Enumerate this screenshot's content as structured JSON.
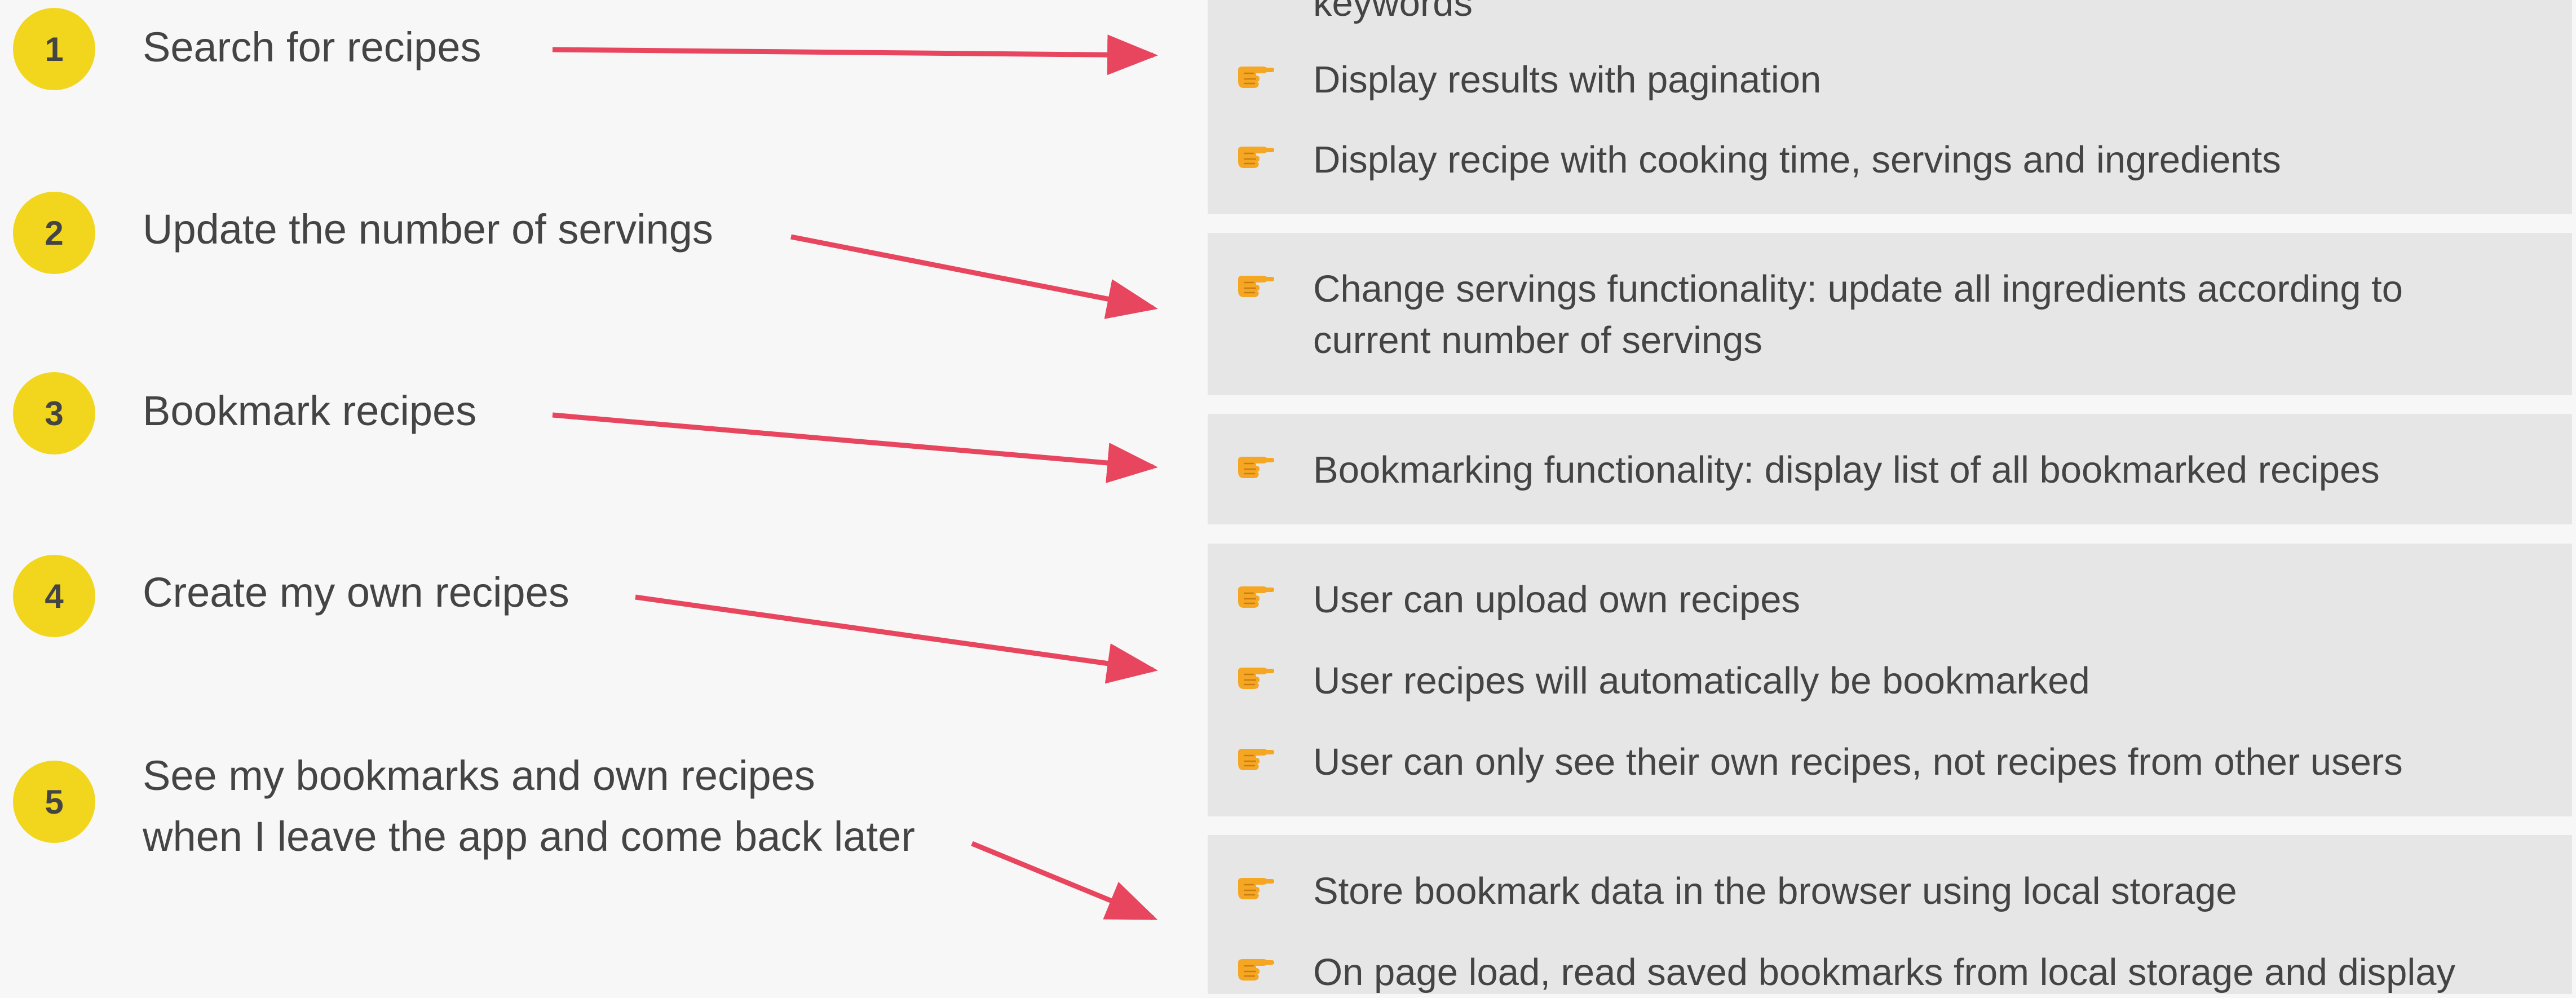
{
  "colors": {
    "background": "#f7f7f7",
    "panel": "#e6e6e6",
    "badge": "#f2d61e",
    "arrow": "#e8455e",
    "text": "#444444",
    "hand_icon": "#f5a623"
  },
  "stories": [
    {
      "number": "1",
      "lines": [
        "Search for recipes"
      ]
    },
    {
      "number": "2",
      "lines": [
        "Update the number of servings"
      ]
    },
    {
      "number": "3",
      "lines": [
        "Bookmark recipes"
      ]
    },
    {
      "number": "4",
      "lines": [
        "Create my own recipes"
      ]
    },
    {
      "number": "5",
      "lines": [
        "See my bookmarks and own recipes",
        "when I leave the app and come back later"
      ]
    }
  ],
  "features": [
    {
      "items": [
        {
          "icon": "pointing-hand-icon",
          "lines": [
            "keywords"
          ]
        },
        {
          "icon": "pointing-hand-icon",
          "lines": [
            "Display results with pagination"
          ]
        },
        {
          "icon": "pointing-hand-icon",
          "lines": [
            "Display recipe with cooking time, servings and ingredients"
          ]
        }
      ]
    },
    {
      "items": [
        {
          "icon": "pointing-hand-icon",
          "lines": [
            "Change servings functionality: update all ingredients according to",
            "current number of servings"
          ]
        }
      ]
    },
    {
      "items": [
        {
          "icon": "pointing-hand-icon",
          "lines": [
            "Bookmarking functionality: display list of all bookmarked recipes"
          ]
        }
      ]
    },
    {
      "items": [
        {
          "icon": "pointing-hand-icon",
          "lines": [
            "User can upload own recipes"
          ]
        },
        {
          "icon": "pointing-hand-icon",
          "lines": [
            "User recipes will automatically be bookmarked"
          ]
        },
        {
          "icon": "pointing-hand-icon",
          "lines": [
            "User can only see their own recipes, not recipes from other users"
          ]
        }
      ]
    },
    {
      "items": [
        {
          "icon": "pointing-hand-icon",
          "lines": [
            "Store bookmark data in the browser using local storage"
          ]
        },
        {
          "icon": "pointing-hand-icon",
          "lines": [
            "On page load, read saved bookmarks from local storage and display"
          ]
        }
      ]
    }
  ]
}
